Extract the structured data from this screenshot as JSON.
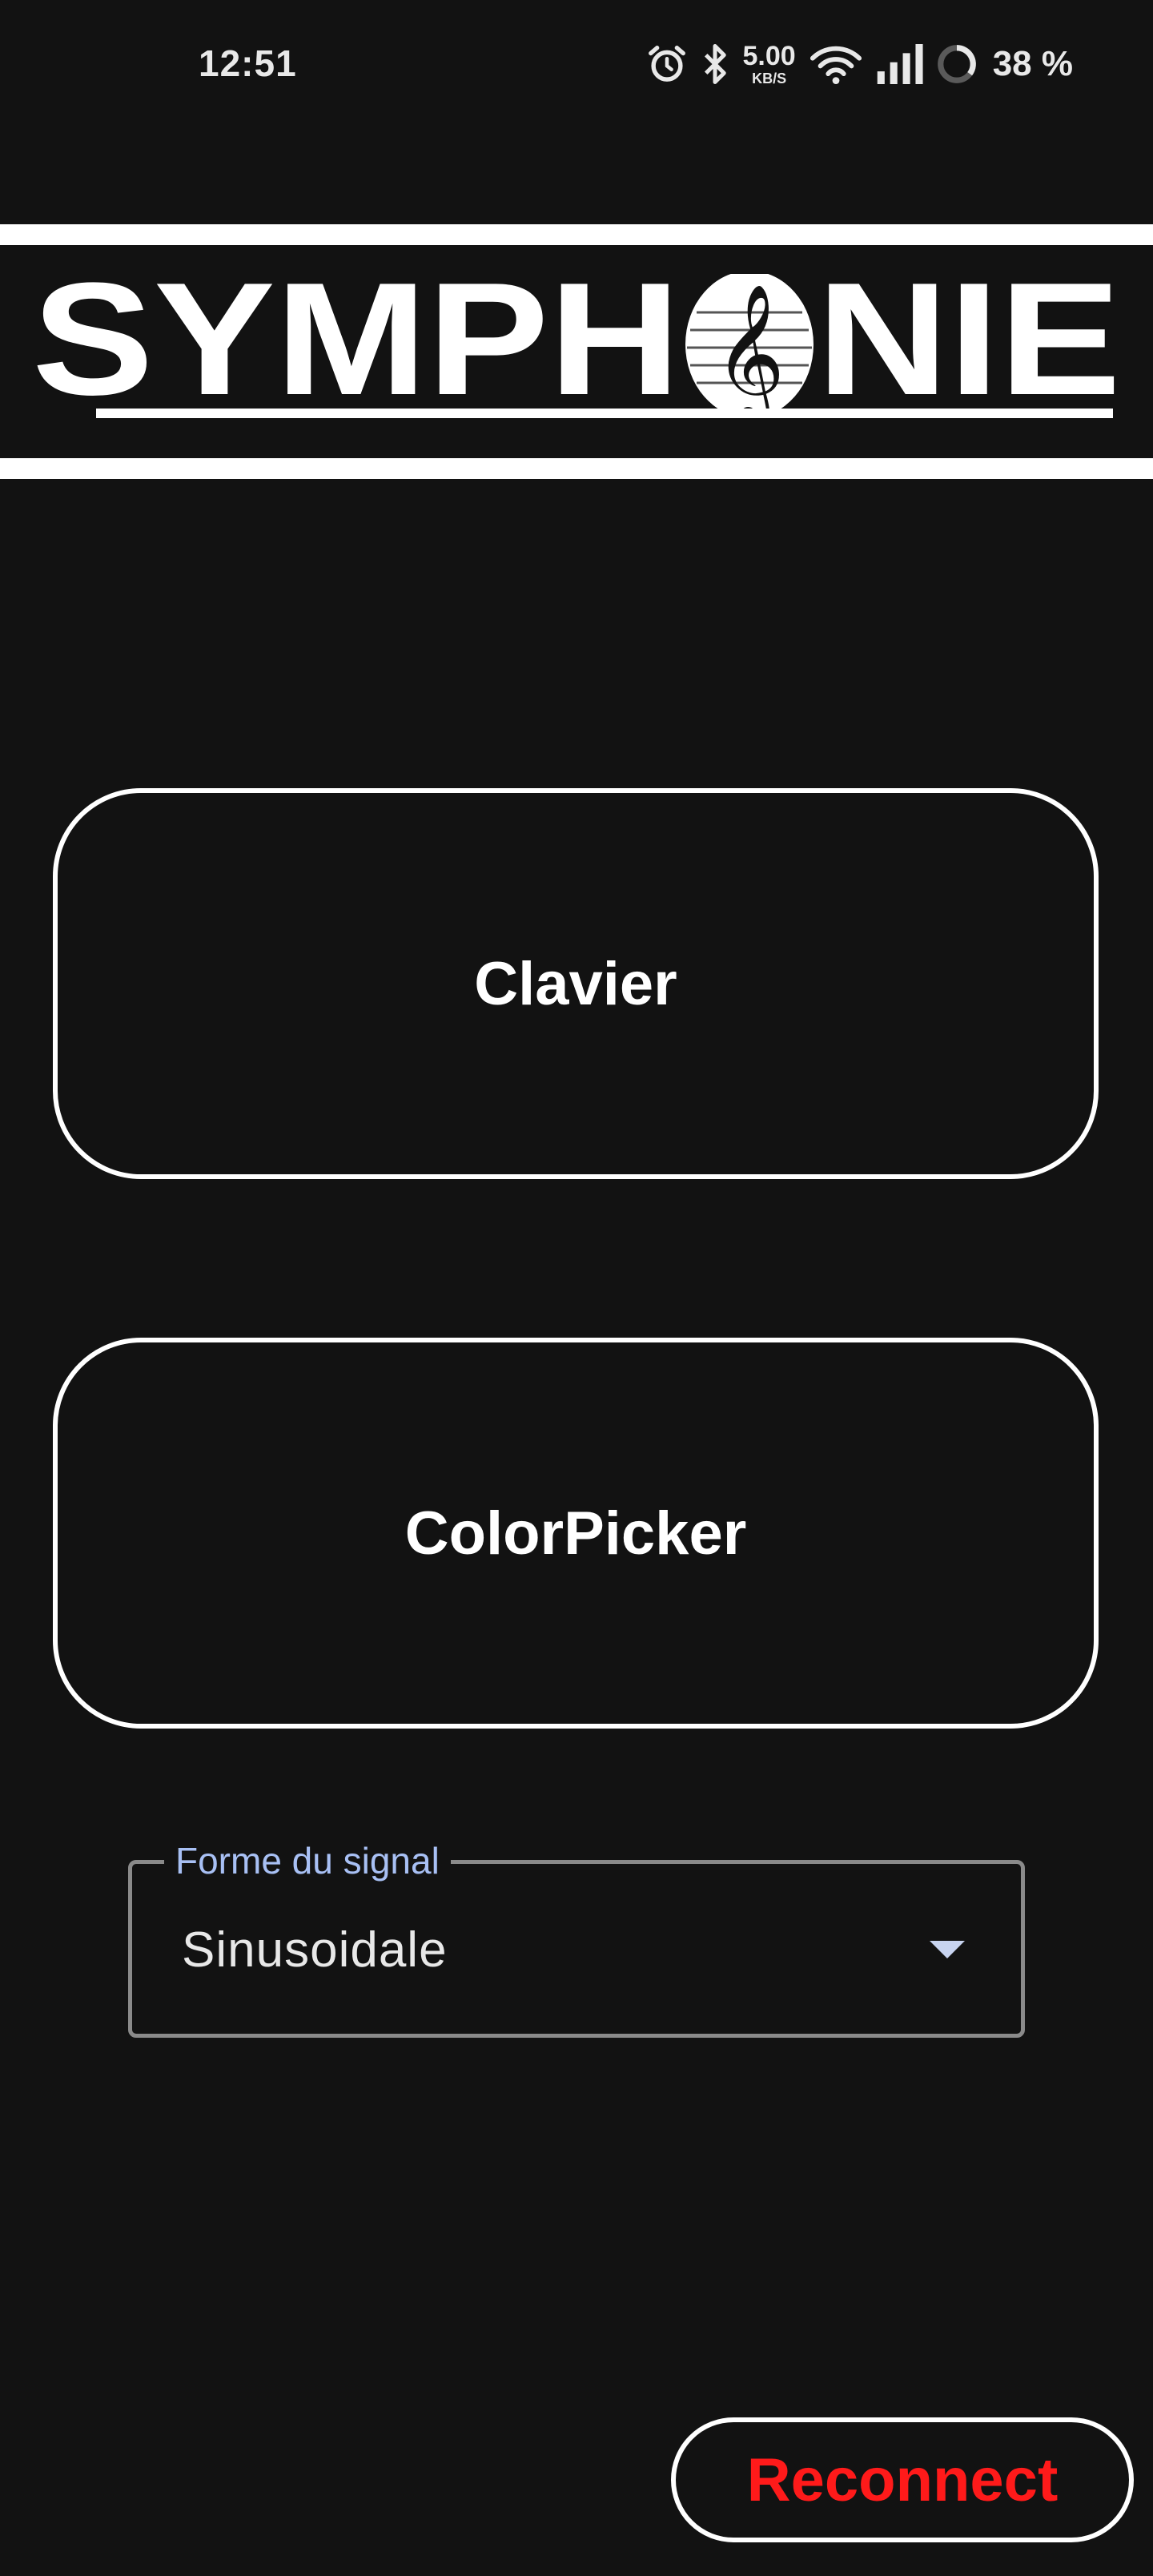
{
  "status_bar": {
    "time": "12:51",
    "net_speed_value": "5.00",
    "net_speed_unit": "KB/S",
    "battery": "38 %",
    "icons": [
      "alarm-icon",
      "bluetooth-icon",
      "wifi-icon",
      "signal-icon",
      "battery-ring-icon"
    ]
  },
  "logo": {
    "text": "SYMPHONIE",
    "emblem": "treble-clef-icon"
  },
  "buttons": {
    "clavier": "Clavier",
    "color_picker": "ColorPicker",
    "reconnect": "Reconnect"
  },
  "signal_select": {
    "label": "Forme du signal",
    "value": "Sinusoidale"
  },
  "colors": {
    "background": "#121212",
    "foreground": "#ffffff",
    "accent_label": "#a8c0f4",
    "reconnect_text": "#ff1a1a"
  }
}
